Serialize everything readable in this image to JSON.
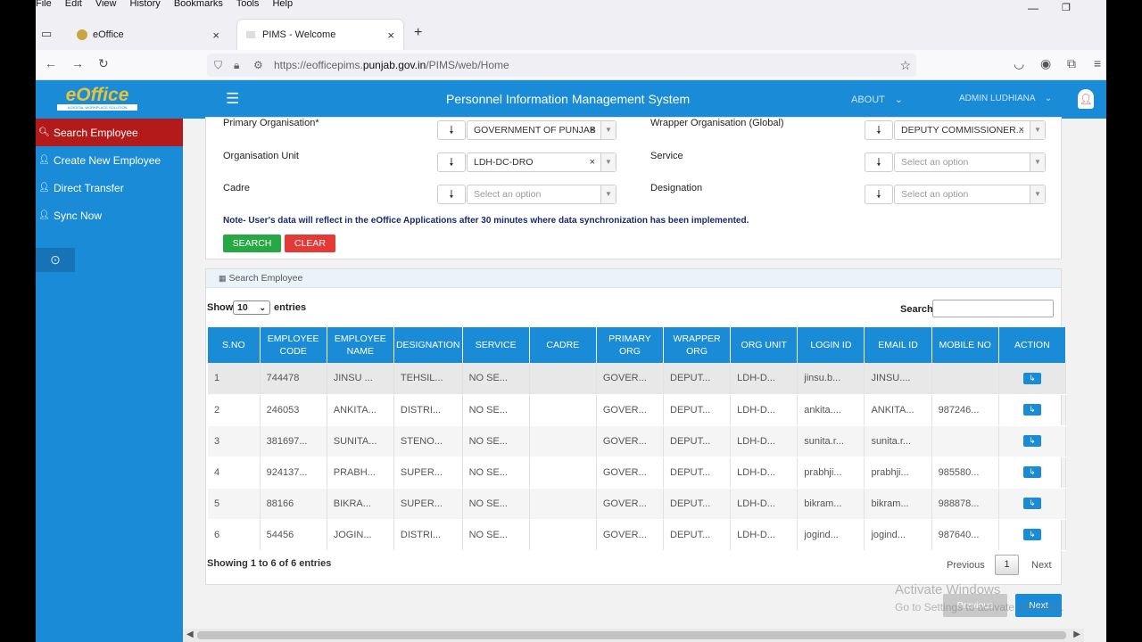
{
  "browser": {
    "menu": [
      "File",
      "Edit",
      "View",
      "History",
      "Bookmarks",
      "Tools",
      "Help"
    ],
    "tabs": [
      {
        "title": "eOffice"
      },
      {
        "title": "PIMS - Welcome"
      }
    ],
    "url_prefix": "https://eofficepims.",
    "url_host": "punjab.gov.in",
    "url_path": "/PIMS/web/Home"
  },
  "header": {
    "logo_text": "eOffice",
    "logo_tagline": "A DIGITAL WORKPLACE SOLUTION",
    "title": "Personnel Information Management System",
    "about": "ABOUT",
    "user": "ADMIN LUDHIANA"
  },
  "sidebar": {
    "items": [
      {
        "label": "Search Employee"
      },
      {
        "label": "Create New Employee"
      },
      {
        "label": "Direct Transfer"
      },
      {
        "label": "Sync Now"
      }
    ]
  },
  "filters": {
    "primary_org_label": "Primary Organisation*",
    "primary_org_value": "GOVERNMENT OF PUNJAB",
    "wrapper_org_label": "Wrapper Organisation (Global)",
    "wrapper_org_value": "DEPUTY COMMISSIONER...",
    "org_unit_label": "Organisation Unit",
    "org_unit_value": "LDH-DC-DRO",
    "service_label": "Service",
    "service_placeholder": "Select an option",
    "cadre_label": "Cadre",
    "cadre_placeholder": "Select an option",
    "designation_label": "Designation",
    "designation_placeholder": "Select an option",
    "note": "Note- User's data will reflect in the eOffice Applications after 30 minutes where data synchronization has been implemented.",
    "search_btn": "SEARCH",
    "clear_btn": "CLEAR"
  },
  "results": {
    "panel_title": "Search Employee",
    "show_label": "Show",
    "entries_value": "10",
    "entries_label": "entries",
    "search_label": "Search:",
    "columns": [
      "S.NO",
      "EMPLOYEE CODE",
      "EMPLOYEE NAME",
      "DESIGNATION",
      "SERVICE",
      "CADRE",
      "PRIMARY ORG",
      "WRAPPER ORG",
      "ORG UNIT",
      "LOGIN ID",
      "EMAIL ID",
      "MOBILE NO",
      "ACTION"
    ],
    "rows": [
      [
        "1",
        "744478",
        "JINSU ...",
        "TEHSIL...",
        "NO SE...",
        "",
        "GOVER...",
        "DEPUT...",
        "LDH-D...",
        "jinsu.b...",
        "JINSU....",
        ""
      ],
      [
        "2",
        "246053",
        "ANKITA...",
        "DISTRI...",
        "NO SE...",
        "",
        "GOVER...",
        "DEPUT...",
        "LDH-D...",
        "ankita....",
        "ANKITA...",
        "987246..."
      ],
      [
        "3",
        "381697...",
        "SUNITA...",
        "STENO...",
        "NO SE...",
        "",
        "GOVER...",
        "DEPUT...",
        "LDH-D...",
        "sunita.r...",
        "sunita.r...",
        ""
      ],
      [
        "4",
        "924137...",
        "PRABH...",
        "SUPER...",
        "NO SE...",
        "",
        "GOVER...",
        "DEPUT...",
        "LDH-D...",
        "prabhji...",
        "prabhji...",
        "985580..."
      ],
      [
        "5",
        "88166",
        "BIKRA...",
        "SUPER...",
        "NO SE...",
        "",
        "GOVER...",
        "DEPUT...",
        "LDH-D...",
        "bikram...",
        "bikram...",
        "988878..."
      ],
      [
        "6",
        "54456",
        "JOGIN...",
        "DISTRI...",
        "NO SE...",
        "",
        "GOVER...",
        "DEPUT...",
        "LDH-D...",
        "jogind...",
        "jogind...",
        "987640..."
      ]
    ],
    "info": "Showing 1 to 6 of 6 entries",
    "prev": "Previous",
    "page": "1",
    "next": "Next"
  },
  "footer": {
    "prev_btn": "Previous",
    "next_btn": "Next",
    "watermark1": "Activate Windows",
    "watermark2": "Go to Settings to activate Windows."
  }
}
